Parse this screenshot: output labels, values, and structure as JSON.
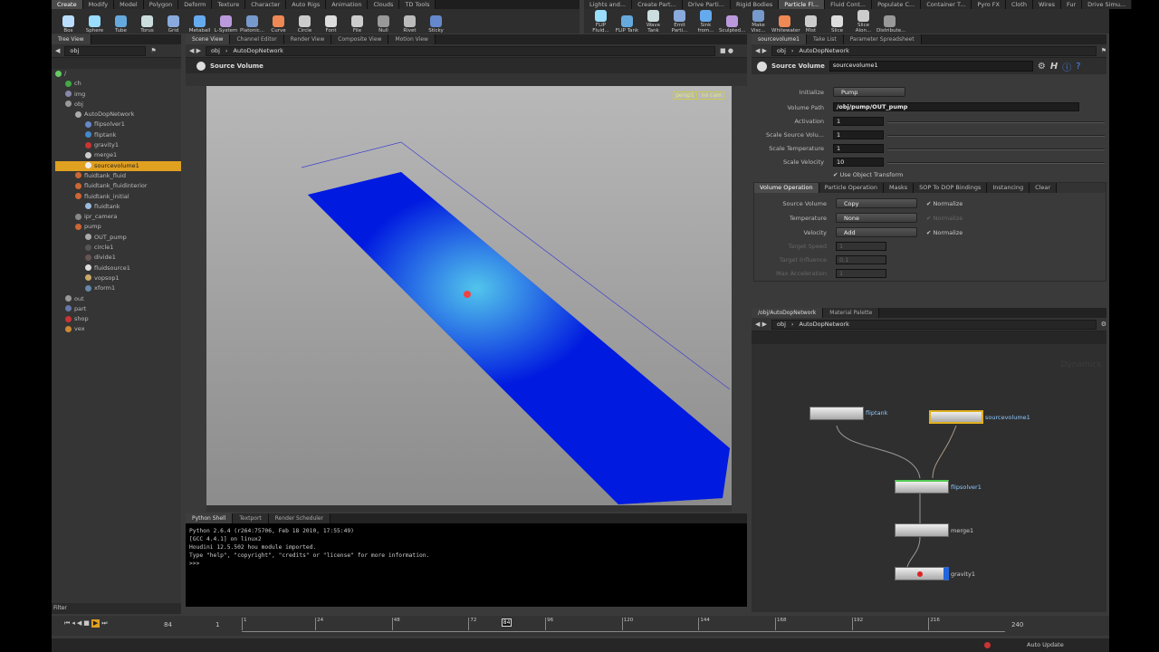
{
  "shelf_left": {
    "tabs": [
      "Create",
      "Modify",
      "Model",
      "Polygon",
      "Deform",
      "Texture",
      "Character",
      "Auto Rigs",
      "Animation",
      "Clouds",
      "TD Tools"
    ],
    "tools": [
      "Box",
      "Sphere",
      "Tube",
      "Torus",
      "Grid",
      "Metaball",
      "L-System",
      "Platonic...",
      "Curve",
      "Circle",
      "Font",
      "File",
      "Null",
      "Rivet",
      "Sticky"
    ]
  },
  "shelf_right": {
    "tabs": [
      "Lights and...",
      "Create Part...",
      "Drive Parti...",
      "Rigid Bodies",
      "Particle Fl...",
      "Fluid Cont...",
      "Populate C...",
      "Container T...",
      "Pyro FX",
      "Cloth",
      "Wires",
      "Fur",
      "Drive Simu..."
    ],
    "active_tab": "Particle Fl...",
    "tools": [
      "FLIP Fluid...",
      "FLIP Tank",
      "Wave Tank",
      "Emit Parti...",
      "Sink from...",
      "Sculpted...",
      "Make Visc...",
      "Whitewater",
      "Mist",
      "Slice",
      "Slice Alon...",
      "Distribute..."
    ]
  },
  "tree_view": {
    "tab": "Tree View",
    "path": "obj",
    "filter_label": "Filter",
    "items": [
      {
        "label": "/",
        "depth": 0,
        "color": "#6c6"
      },
      {
        "label": "ch",
        "depth": 1,
        "color": "#4a4"
      },
      {
        "label": "img",
        "depth": 1,
        "color": "#88a"
      },
      {
        "label": "obj",
        "depth": 1,
        "color": "#999"
      },
      {
        "label": "AutoDopNetwork",
        "depth": 2,
        "color": "#aaa"
      },
      {
        "label": "flipsolver1",
        "depth": 3,
        "color": "#68c"
      },
      {
        "label": "fliptank",
        "depth": 3,
        "color": "#48c"
      },
      {
        "label": "gravity1",
        "depth": 3,
        "color": "#c33"
      },
      {
        "label": "merge1",
        "depth": 3,
        "color": "#ccc"
      },
      {
        "label": "sourcevolume1",
        "depth": 3,
        "color": "#eee",
        "selected": true
      },
      {
        "label": "fluidtank_fluid",
        "depth": 2,
        "color": "#c63"
      },
      {
        "label": "fluidtank_fluidinterior",
        "depth": 2,
        "color": "#c63"
      },
      {
        "label": "fluidtank_initial",
        "depth": 2,
        "color": "#c63"
      },
      {
        "label": "fluidtank",
        "depth": 3,
        "color": "#9bd"
      },
      {
        "label": "ipr_camera",
        "depth": 2,
        "color": "#888"
      },
      {
        "label": "pump",
        "depth": 2,
        "color": "#c63"
      },
      {
        "label": "OUT_pump",
        "depth": 3,
        "color": "#aaa"
      },
      {
        "label": "circle1",
        "depth": 3,
        "color": "#555"
      },
      {
        "label": "divide1",
        "depth": 3,
        "color": "#655"
      },
      {
        "label": "fluidsource1",
        "depth": 3,
        "color": "#ddd"
      },
      {
        "label": "vopsop1",
        "depth": 3,
        "color": "#ca6"
      },
      {
        "label": "xform1",
        "depth": 3,
        "color": "#68a"
      },
      {
        "label": "out",
        "depth": 1,
        "color": "#999"
      },
      {
        "label": "part",
        "depth": 1,
        "color": "#67a"
      },
      {
        "label": "shop",
        "depth": 1,
        "color": "#c33"
      },
      {
        "label": "vex",
        "depth": 1,
        "color": "#c83"
      }
    ]
  },
  "scene_view": {
    "tabs": [
      "Scene View",
      "Channel Editor",
      "Render View",
      "Composite View",
      "Motion View"
    ],
    "path": [
      "obj",
      "AutoDopNetwork"
    ],
    "operation_title": "Source Volume",
    "cam_labels": [
      "persp1",
      "no cam"
    ]
  },
  "python_shell": {
    "tabs": [
      "Python Shell",
      "Textport",
      "Render Scheduler"
    ],
    "lines": [
      "Python 2.6.4 (r264:75706, Feb 18 2010, 17:55:49)",
      "[GCC 4.4.1] on linux2",
      "Houdini 12.5.502 hou module imported.",
      "Type \"help\", \"copyright\", \"credits\" or \"license\" for more information.",
      ">>>"
    ]
  },
  "parameters": {
    "tabs": [
      "sourcevolume1",
      "Take List",
      "Parameter Spreadsheet"
    ],
    "path": [
      "obj",
      "AutoDopNetwork"
    ],
    "node_type": "Source Volume",
    "node_name": "sourcevolume1",
    "initialize_label": "Initialize",
    "initialize": "Pump",
    "volume_path_label": "Volume Path",
    "volume_path": "/obj/pump/OUT_pump",
    "activation_label": "Activation",
    "activation": "1",
    "scale_source_label": "Scale Source Volu...",
    "scale_source": "1",
    "scale_temp_label": "Scale Temperature",
    "scale_temp": "1",
    "scale_vel_label": "Scale Velocity",
    "scale_vel": "10",
    "use_object_transform": "Use Object Transform",
    "subtabs": [
      "Volume Operation",
      "Particle Operation",
      "Masks",
      "SOP To DOP Bindings",
      "Instancing",
      "Clear"
    ],
    "source_volume_label": "Source Volume",
    "source_volume": "Copy",
    "temperature_label": "Temperature",
    "temperature": "None",
    "velocity_label": "Velocity",
    "velocity": "Add",
    "normalize": "Normalize",
    "target_speed_label": "Target Speed",
    "target_speed": "1",
    "target_influence_label": "Target Influence",
    "target_influence": "0.1",
    "max_accel_label": "Max Acceleration",
    "max_accel": "1"
  },
  "network": {
    "tabs": [
      "/obj/AutoDopNetwork",
      "Material Palette"
    ],
    "path": [
      "obj",
      "AutoDopNetwork"
    ],
    "context_watermark": "Dynamics",
    "nodes": [
      "fliptank",
      "sourcevolume1",
      "flipsolver1",
      "merge1",
      "gravity1"
    ]
  },
  "timeline": {
    "current_frame": "84",
    "start": "1",
    "end": "240",
    "frame_field": "84",
    "ticks": [
      "1",
      "24",
      "48",
      "72",
      "96",
      "120",
      "144",
      "168",
      "192",
      "216"
    ],
    "auto_update": "Auto Update"
  }
}
